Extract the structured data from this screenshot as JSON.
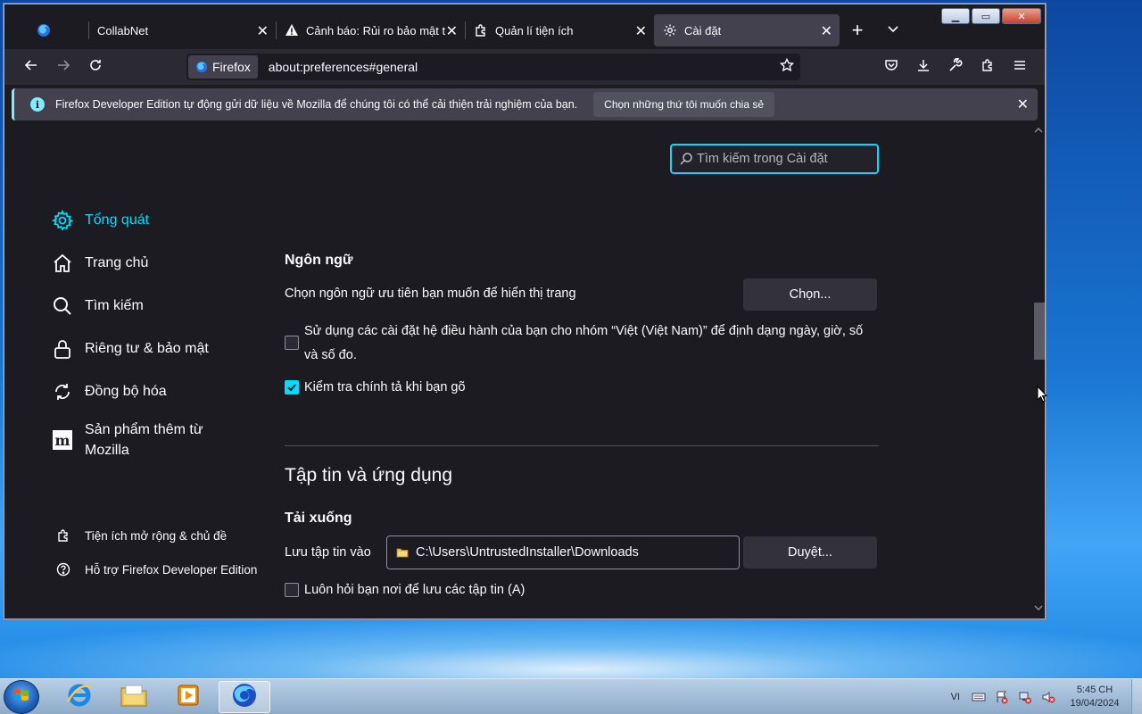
{
  "browser": {
    "tabs": [
      {
        "label": "",
        "icon": "firefox-icon"
      },
      {
        "label": "CollabNet",
        "icon": ""
      },
      {
        "label": "Cảnh báo: Rủi ro bảo mật tiềm",
        "icon": "warning-icon"
      },
      {
        "label": "Quản lí tiện ích",
        "icon": "puzzle-icon"
      },
      {
        "label": "Cài đặt",
        "icon": "gear-icon",
        "active": true
      }
    ],
    "identity_label": "Firefox",
    "url": "about:preferences#general"
  },
  "notification": {
    "text": "Firefox Developer Edition tự động gửi dữ liệu về Mozilla để chúng tôi có thể cải thiện trải nghiệm của bạn.",
    "button": "Chọn những thứ tôi muốn chia sẻ"
  },
  "search": {
    "placeholder": "Tìm kiếm trong Cài đặt"
  },
  "sidebar": {
    "items": [
      {
        "label": "Tổng quát",
        "icon": "gear-icon",
        "active": true
      },
      {
        "label": "Trang chủ",
        "icon": "home-icon"
      },
      {
        "label": "Tìm kiếm",
        "icon": "search-icon"
      },
      {
        "label": "Riêng tư & bảo mật",
        "icon": "lock-icon"
      },
      {
        "label": "Đồng bộ hóa",
        "icon": "sync-icon"
      },
      {
        "label": "Sản phẩm thêm từ Mozilla",
        "icon": "mozilla-icon"
      }
    ],
    "footer": [
      {
        "label": "Tiện ích mở rộng & chủ đề",
        "icon": "puzzle-icon"
      },
      {
        "label": "Hỗ trợ Firefox Developer Edition",
        "icon": "help-icon"
      }
    ]
  },
  "main": {
    "language_heading": "Ngôn ngữ",
    "language_desc": "Chọn ngôn ngữ ưu tiên bạn muốn để hiển thị trang",
    "choose_button": "Chọn...",
    "os_locale_checkbox": "Sử dụng các cài đặt hệ điều hành của bạn cho nhóm “Việt (Việt Nam)” để định dạng ngày, giờ, số và số đo.",
    "os_locale_checked": false,
    "spellcheck_checkbox": "Kiểm tra chính tả khi bạn gõ",
    "spellcheck_checked": true,
    "files_heading": "Tập tin và ứng dụng",
    "downloads_heading": "Tải xuống",
    "save_to_label": "Lưu tập tin vào",
    "download_path": "C:\\Users\\UntrustedInstaller\\Downloads",
    "browse_button": "Duyệt...",
    "always_ask_checkbox": "Luôn hỏi bạn nơi để lưu các tập tin (A)",
    "always_ask_checked": false
  },
  "taskbar": {
    "apps": [
      "internet-explorer-icon",
      "file-explorer-icon",
      "media-player-icon",
      "firefox-icon"
    ],
    "language": "VI",
    "time": "5:45 CH",
    "date": "19/04/2024"
  },
  "colors": {
    "accent": "#00ddff",
    "background": "#1c1b22",
    "toolbar": "#2b2a33"
  }
}
